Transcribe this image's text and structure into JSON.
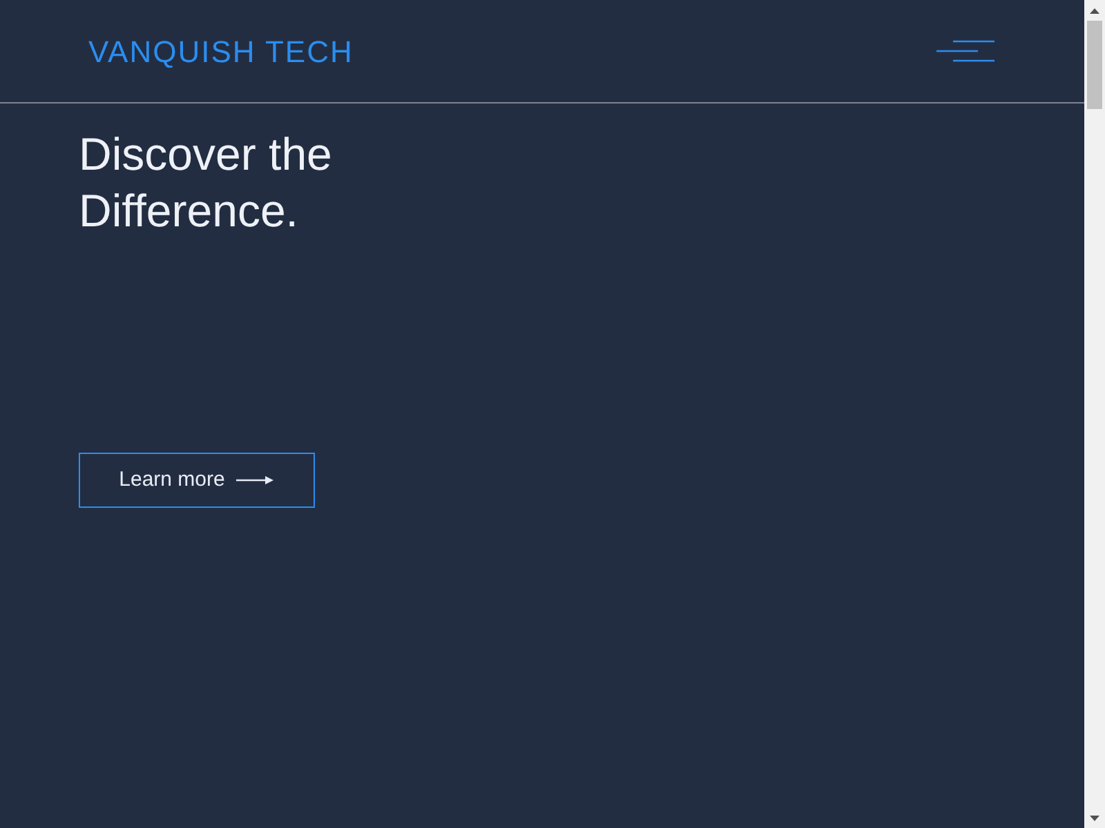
{
  "header": {
    "logo": "VANQUISH TECH"
  },
  "hero": {
    "title_lines": [
      "Discover the",
      "Difference."
    ],
    "button": "Learn more"
  }
}
